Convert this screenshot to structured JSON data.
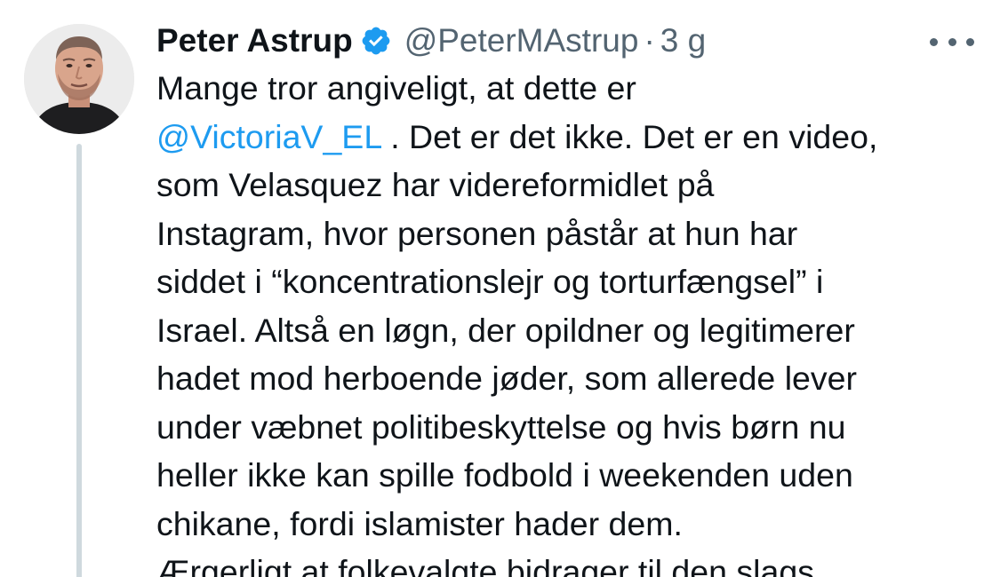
{
  "author": {
    "name": "Peter Astrup",
    "handle": "@PeterMAstrup",
    "separator": "·",
    "time": "3 g",
    "verified": true,
    "verified_color": "#1d9bf0"
  },
  "icons": {
    "verified": "verified-badge-icon",
    "more": "more-options-icon"
  },
  "tweet": {
    "line1": "Mange tror angiveligt, at dette er",
    "mention": "@VictoriaV_EL",
    "line2_rest": " . Det er det ikke. Det er en video,",
    "line3": "som Velasquez har videreformidlet på",
    "line4": "Instagram, hvor personen påstår at hun har",
    "line5": "siddet i “koncentrationslejr og torturfængsel” i",
    "line6": "Israel. Altså en løgn, der opildner og legitimerer",
    "line7": "hadet mod herboende jøder, som allerede lever",
    "line8": "under væbnet politibeskyttelse og hvis børn nu",
    "line9": "heller ikke kan spille fodbold i weekenden uden",
    "line10": "chikane, fordi islamister hader dem.",
    "line11": "Ærgerligt at folkevalgte bidrager til den slags"
  },
  "colors": {
    "text": "#0f1419",
    "secondary": "#536471",
    "link": "#1d9bf0",
    "thread_line": "#cfd9de"
  }
}
